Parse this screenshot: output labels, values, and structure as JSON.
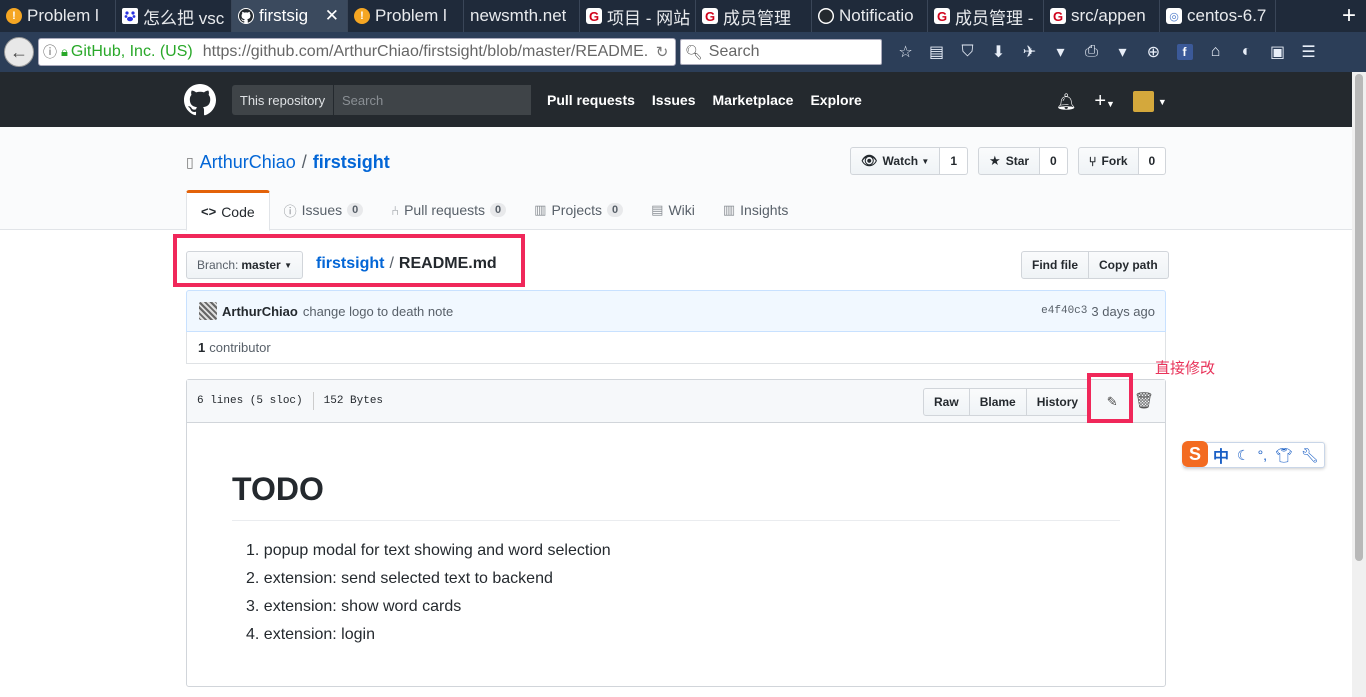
{
  "browser": {
    "tabs": [
      {
        "title": "Problem l",
        "favicon": "warning-icon",
        "active": false
      },
      {
        "title": "怎么把 vsc",
        "favicon": "baidu-icon",
        "active": false
      },
      {
        "title": "firstsig",
        "favicon": "github-icon",
        "active": true
      },
      {
        "title": "Problem l",
        "favicon": "warning-icon",
        "active": false
      },
      {
        "title": "newsmth.net",
        "favicon": "none",
        "active": false
      },
      {
        "title": "项目 - 网站",
        "favicon": "gitee-icon",
        "active": false
      },
      {
        "title": "成员管理",
        "favicon": "gitee-icon",
        "active": false
      },
      {
        "title": "Notificatio",
        "favicon": "github-icon",
        "active": false
      },
      {
        "title": "成员管理 -",
        "favicon": "gitee-icon",
        "active": false
      },
      {
        "title": "src/appen",
        "favicon": "gitee-icon",
        "active": false
      },
      {
        "title": "centos-6.7",
        "favicon": "globe-icon",
        "active": false
      }
    ],
    "new_tab": "+",
    "close_tab": "✕",
    "url_org": "GitHub, Inc. (US)",
    "url": "https://github.com/ArthurChiao/firstsight/blob/master/README.md",
    "search_placeholder": "Search"
  },
  "header": {
    "scope_label": "This repository",
    "search_placeholder": "Search",
    "nav": [
      "Pull requests",
      "Issues",
      "Marketplace",
      "Explore"
    ]
  },
  "repo": {
    "owner": "ArthurChiao",
    "separator": "/",
    "name": "firstsight",
    "watch": {
      "label": "Watch",
      "count": "1"
    },
    "star": {
      "label": "Star",
      "count": "0"
    },
    "fork": {
      "label": "Fork",
      "count": "0"
    },
    "tabs": [
      {
        "label": "Code",
        "icon": "code-icon",
        "count": null
      },
      {
        "label": "Issues",
        "icon": "issue-icon",
        "count": "0"
      },
      {
        "label": "Pull requests",
        "icon": "pull-request-icon",
        "count": "0"
      },
      {
        "label": "Projects",
        "icon": "project-icon",
        "count": "0"
      },
      {
        "label": "Wiki",
        "icon": "book-icon",
        "count": null
      },
      {
        "label": "Insights",
        "icon": "graph-icon",
        "count": null
      }
    ]
  },
  "file_nav": {
    "branch_prefix": "Branch:",
    "branch": "master",
    "crumb_repo": "firstsight",
    "crumb_sep": "/",
    "crumb_file": "README.md",
    "find_file": "Find file",
    "copy_path": "Copy path"
  },
  "commit": {
    "author": "ArthurChiao",
    "message": "change logo to death note",
    "sha": "e4f40c3",
    "time": "3 days ago",
    "contributors_count": "1",
    "contributors_label": "contributor"
  },
  "annotation": "直接修改",
  "file": {
    "lines": "6 lines (5 sloc)",
    "size": "152 Bytes",
    "actions": [
      "Raw",
      "Blame",
      "History"
    ],
    "readme_title": "TODO",
    "todo_items": [
      "popup modal for text showing and word selection",
      "extension: send selected text to backend",
      "extension: show word cards",
      "extension: login"
    ]
  },
  "ime": {
    "logo": "S",
    "lang": "中"
  },
  "colors": {
    "highlight": "#f0285a",
    "link": "#0366d6",
    "header_bg": "#24292e",
    "tab_accent": "#e36209"
  }
}
